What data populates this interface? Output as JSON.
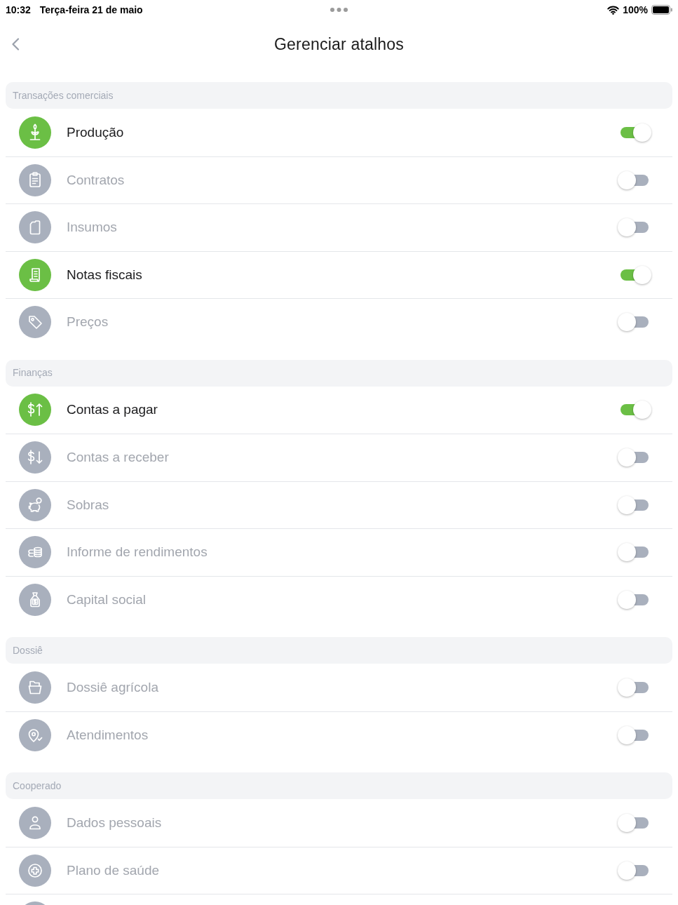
{
  "status_bar": {
    "time": "10:32",
    "date": "Terça-feira 21 de maio",
    "battery": "100%"
  },
  "header": {
    "title": "Gerenciar atalhos"
  },
  "sections": [
    {
      "title": "Transações comerciais",
      "items": [
        {
          "label": "Produção",
          "enabled": true
        },
        {
          "label": "Contratos",
          "enabled": false
        },
        {
          "label": "Insumos",
          "enabled": false
        },
        {
          "label": "Notas fiscais",
          "enabled": true
        },
        {
          "label": "Preços",
          "enabled": false
        }
      ]
    },
    {
      "title": "Finanças",
      "items": [
        {
          "label": "Contas a pagar",
          "enabled": true
        },
        {
          "label": "Contas a receber",
          "enabled": false
        },
        {
          "label": "Sobras",
          "enabled": false
        },
        {
          "label": "Informe de rendimentos",
          "enabled": false
        },
        {
          "label": "Capital social",
          "enabled": false
        }
      ]
    },
    {
      "title": "Dossiê",
      "items": [
        {
          "label": "Dossiê agrícola",
          "enabled": false
        },
        {
          "label": "Atendimentos",
          "enabled": false
        }
      ]
    },
    {
      "title": "Cooperado",
      "items": [
        {
          "label": "Dados pessoais",
          "enabled": false
        },
        {
          "label": "Plano de saúde",
          "enabled": false
        }
      ]
    }
  ]
}
